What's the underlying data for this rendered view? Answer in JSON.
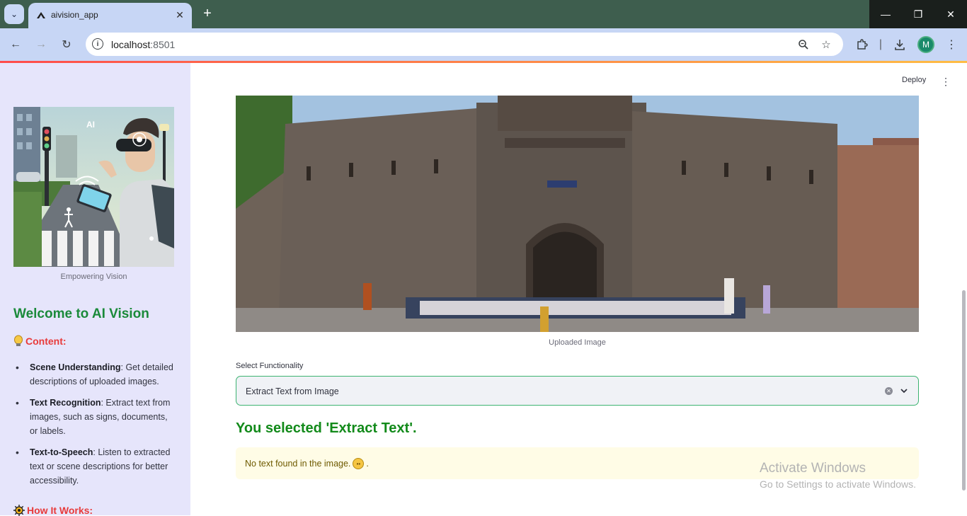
{
  "browser": {
    "tab_title": "aivision_app",
    "url_host": "localhost",
    "url_port": ":8501",
    "avatar_letter": "M"
  },
  "sidebar": {
    "image_caption": "Empowering Vision",
    "title": "Welcome to AI Vision",
    "content_header": "Content:",
    "features": [
      {
        "name": "Scene Understanding",
        "desc": ": Get detailed descriptions of uploaded images."
      },
      {
        "name": "Text Recognition",
        "desc": ": Extract text from images, such as signs, documents, or labels."
      },
      {
        "name": "Text-to-Speech",
        "desc": ": Listen to extracted text or scene descriptions for better accessibility."
      }
    ],
    "how_header": "How It Works:"
  },
  "header": {
    "deploy_label": "Deploy"
  },
  "main": {
    "image_caption": "Uploaded Image",
    "select_label": "Select Functionality",
    "select_value": "Extract Text from Image",
    "selected_message": "You selected 'Extract Text'.",
    "alert_text": "No text found in the image.",
    "alert_suffix": "."
  },
  "watermark": {
    "line1": "Activate Windows",
    "line2": "Go to Settings to activate Windows."
  },
  "colors": {
    "sidebar_bg": "#e6e5fb",
    "title_green": "#1a8a3a",
    "header_red": "#e83a3a",
    "select_border": "#3cb371",
    "alert_bg": "#fffce6"
  }
}
